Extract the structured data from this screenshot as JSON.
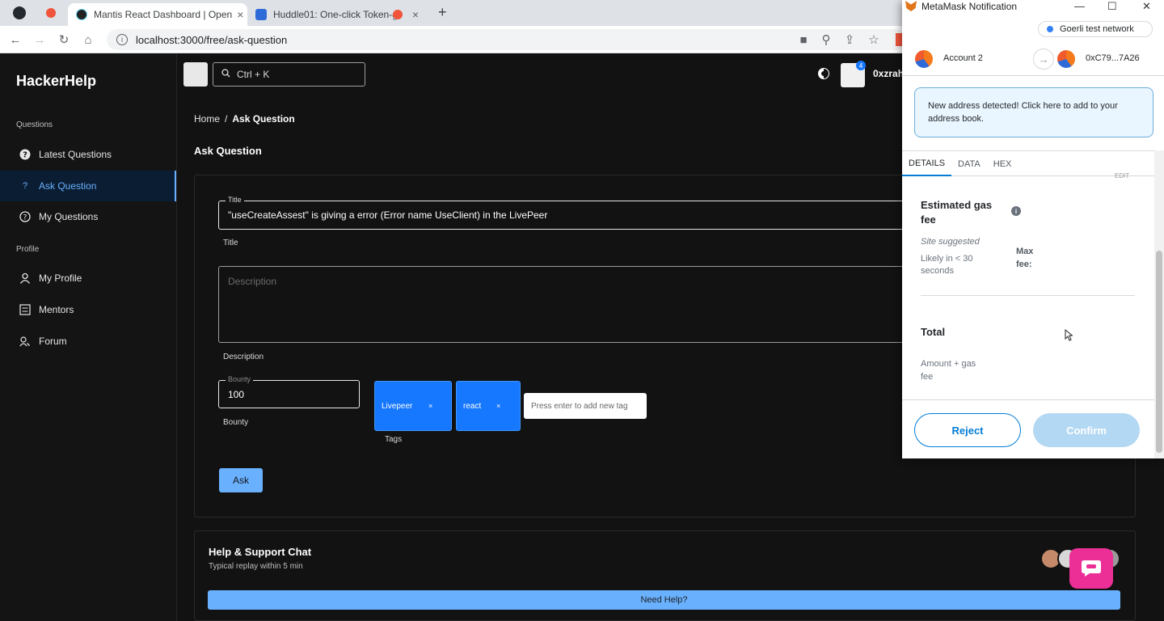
{
  "browser": {
    "tabs": [
      {
        "title": "Mantis React Dashboard | Open"
      },
      {
        "title": "Huddle01: One-click Token-g"
      }
    ],
    "url": "localhost:3000/free/ask-question",
    "new_tab_symbol": "+"
  },
  "sidebar": {
    "brand": "HackerHelp",
    "sections": [
      "Questions",
      "Profile"
    ],
    "items": [
      {
        "label": "Latest Questions",
        "icon": "question-circle-icon"
      },
      {
        "label": "Ask Question",
        "icon": "question-icon"
      },
      {
        "label": "My Questions",
        "icon": "question-circle-icon"
      },
      {
        "label": "My Profile",
        "icon": "user-icon"
      },
      {
        "label": "Mentors",
        "icon": "list-icon"
      },
      {
        "label": "Forum",
        "icon": "team-icon"
      }
    ]
  },
  "header": {
    "search_placeholder": "Ctrl + K",
    "notification_count": "4",
    "username": "0xzrah"
  },
  "breadcrumb": {
    "home": "Home",
    "sep": "/",
    "current": "Ask Question"
  },
  "page_title": "Ask Question",
  "form": {
    "title_label": "Title",
    "title_value": "\"useCreateAssest\" is giving a error (Error name UseClient) in the LivePeer",
    "title_helper": "Title",
    "description_placeholder": "Description",
    "description_helper": "Description",
    "bounty_label": "Bounty",
    "bounty_value": "100",
    "bounty_helper": "Bounty",
    "tags": [
      {
        "label": "Livepeer"
      },
      {
        "label": "react"
      }
    ],
    "tag_remove_symbol": "×",
    "tag_input_placeholder": "Press enter to add new tag",
    "tags_helper": "Tags",
    "ask_label": "Ask"
  },
  "help": {
    "title": "Help & Support Chat",
    "subtitle": "Typical replay within 5 min",
    "button": "Need Help?"
  },
  "metamask": {
    "window_title": "MetaMask Notification",
    "network": "Goerli test network",
    "from_account": "Account 2",
    "to_address": "0xC79...7A26",
    "alert": "New address detected! Click here to add to your address book.",
    "tabs": [
      "DETAILS",
      "DATA",
      "HEX"
    ],
    "edit_label": "EDIT",
    "gas_title_1": "Estimated gas",
    "gas_title_2": "fee",
    "site_suggested": "Site suggested",
    "likely_1": "Likely in < 30",
    "likely_2": "seconds",
    "max_fee_1": "Max",
    "max_fee_2": "fee:",
    "total_title": "Total",
    "amount_1": "Amount + gas",
    "amount_2": "fee",
    "reject": "Reject",
    "confirm": "Confirm"
  },
  "colors": {
    "primary": "#1677ff",
    "primary_light": "#69b1ff",
    "metamask_blue": "#037dd6"
  }
}
